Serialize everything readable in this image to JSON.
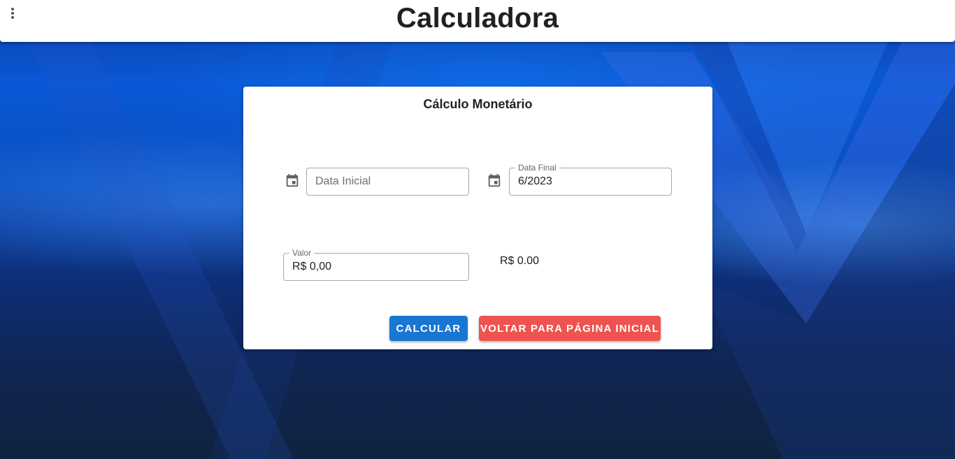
{
  "appbar": {
    "title": "Calculadora",
    "menu_icon": "more-vert-icon"
  },
  "card": {
    "title": "Cálculo Monetário",
    "data_inicial": {
      "icon": "calendar-icon",
      "placeholder": "Data Inicial",
      "value": ""
    },
    "data_final": {
      "icon": "calendar-icon",
      "label": "Data Final",
      "value": "6/2023"
    },
    "valor": {
      "label": "Valor",
      "value": "R$ 0,00"
    },
    "result": "R$ 0.00",
    "calc_button": "CALCULAR",
    "back_button": "VOLTAR PARA PÁGINA INICIAL"
  },
  "colors": {
    "primary": "#1976d2",
    "danger": "#ef5350"
  }
}
